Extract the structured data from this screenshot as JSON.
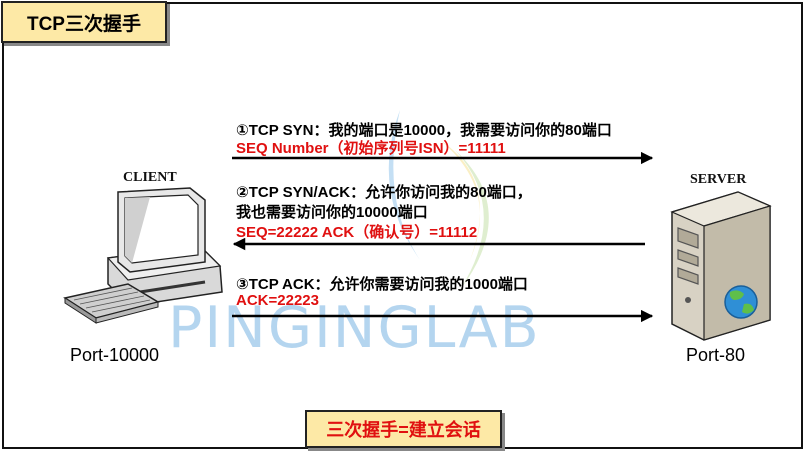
{
  "title": "TCP三次握手",
  "client": {
    "name": "CLIENT",
    "port": "Port-10000"
  },
  "server": {
    "name": "SERVER",
    "port": "Port-80"
  },
  "steps": [
    {
      "line1": "①TCP SYN：我的端口是10000，我需要访问你的80端口",
      "red": "SEQ Number（初始序列号ISN）=11111",
      "direction": "client-to-server"
    },
    {
      "line1": "②TCP SYN/ACK：允许你访问我的80端口，",
      "line2": "我也需要访问你的10000端口",
      "red": "SEQ=22222 ACK（确认号）=11112",
      "direction": "server-to-client"
    },
    {
      "line1": "③TCP ACK：允许你需要访问我的1000端口",
      "red": "ACK=22223",
      "direction": "client-to-server"
    }
  ],
  "footer": "三次握手=建立会话",
  "watermark": "PINGINGLAB",
  "colors": {
    "title_bg": "#fde9a6",
    "highlight": "#e01010",
    "watermark": "#9cc7ea"
  },
  "icons": {
    "client": "desktop-computer-icon",
    "server": "server-tower-icon",
    "globe": "globe-icon"
  }
}
